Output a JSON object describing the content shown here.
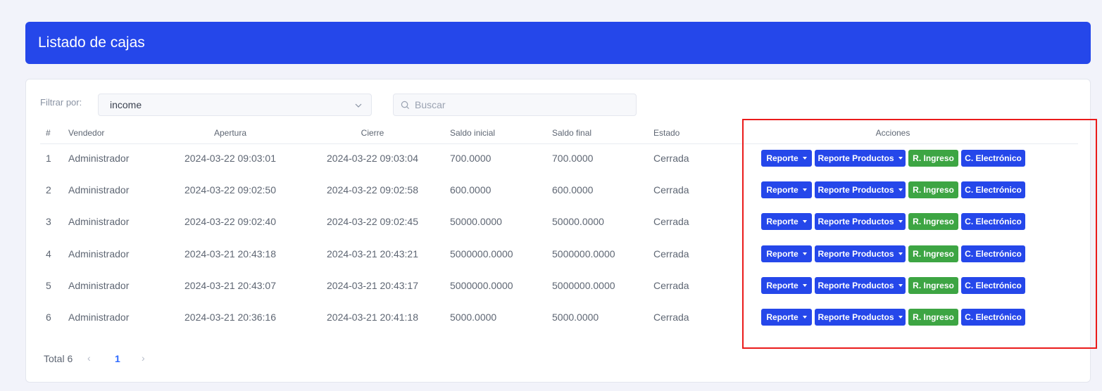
{
  "header": {
    "title": "Listado de cajas"
  },
  "filter": {
    "label": "Filtrar por:",
    "value": "income"
  },
  "search": {
    "placeholder": "Buscar"
  },
  "table": {
    "headers": [
      "#",
      "Vendedor",
      "Apertura",
      "Cierre",
      "Saldo inicial",
      "Saldo final",
      "Estado",
      "Acciones"
    ],
    "rows": [
      {
        "num": "1",
        "vendor": "Administrador",
        "open": "2024-03-22 09:03:01",
        "close": "2024-03-22 09:03:04",
        "initial": "700.0000",
        "final": "700.0000",
        "state": "Cerrada"
      },
      {
        "num": "2",
        "vendor": "Administrador",
        "open": "2024-03-22 09:02:50",
        "close": "2024-03-22 09:02:58",
        "initial": "600.0000",
        "final": "600.0000",
        "state": "Cerrada"
      },
      {
        "num": "3",
        "vendor": "Administrador",
        "open": "2024-03-22 09:02:40",
        "close": "2024-03-22 09:02:45",
        "initial": "50000.0000",
        "final": "50000.0000",
        "state": "Cerrada"
      },
      {
        "num": "4",
        "vendor": "Administrador",
        "open": "2024-03-21 20:43:18",
        "close": "2024-03-21 20:43:21",
        "initial": "5000000.0000",
        "final": "5000000.0000",
        "state": "Cerrada"
      },
      {
        "num": "5",
        "vendor": "Administrador",
        "open": "2024-03-21 20:43:07",
        "close": "2024-03-21 20:43:17",
        "initial": "5000000.0000",
        "final": "5000000.0000",
        "state": "Cerrada"
      },
      {
        "num": "6",
        "vendor": "Administrador",
        "open": "2024-03-21 20:36:16",
        "close": "2024-03-21 20:41:18",
        "initial": "5000.0000",
        "final": "5000.0000",
        "state": "Cerrada"
      }
    ],
    "actions": {
      "reporte": "Reporte",
      "reporte_productos": "Reporte Productos",
      "r_ingreso": "R. Ingreso",
      "c_electronico": "C. Electrónico"
    }
  },
  "pagination": {
    "total": "Total 6",
    "current_page": "1",
    "prev_icon": "chevron-left-icon",
    "next_icon": "chevron-right-icon"
  },
  "colors": {
    "primary": "#2547ea",
    "success": "#3da543",
    "highlight": "#ea1b1b",
    "background": "#f2f3fa"
  }
}
